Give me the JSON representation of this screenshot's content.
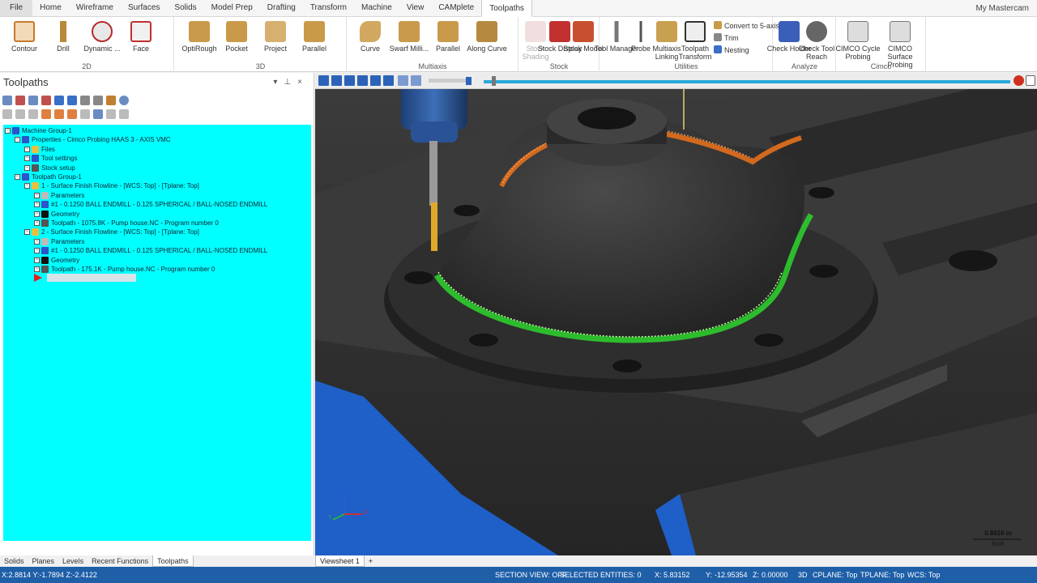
{
  "menu": {
    "tabs": [
      "File",
      "Home",
      "Wireframe",
      "Surfaces",
      "Solids",
      "Model Prep",
      "Drafting",
      "Transform",
      "Machine",
      "View",
      "CAMplete",
      "Toolpaths"
    ],
    "active": "Toolpaths",
    "account": "My Mastercam"
  },
  "ribbon": {
    "groups": {
      "g2d": "2D",
      "g3d": "3D",
      "multiaxis": "Multiaxis",
      "stock": "Stock",
      "utilities": "Utilities",
      "analyze": "Analyze",
      "cimco": "Cimco"
    },
    "buttons": {
      "contour": "Contour",
      "drill": "Drill",
      "dynamic": "Dynamic ...",
      "face": "Face",
      "optirough": "OptiRough",
      "pocket": "Pocket",
      "project": "Project",
      "parallel3d": "Parallel",
      "curve": "Curve",
      "swarf": "Swarf Milli...",
      "parallel_ma": "Parallel",
      "along_curve": "Along Curve",
      "stock_shading": "Stock Shading",
      "stock_display": "Stock Display",
      "stock_model": "Stock Model",
      "tool_manager": "Tool Manager",
      "probe": "Probe",
      "multiaxis_linking": "Multiaxis Linking",
      "toolpath_transform": "Toolpath Transform",
      "convert_5axis": "Convert to 5-axis",
      "trim": "Trim",
      "nesting": "Nesting",
      "check_holder": "Check Holder",
      "check_reach": "Check Tool Reach",
      "cimco_cycle": "CIMCO Cycle Probing",
      "cimco_surface": "CIMCO Surface Probing"
    }
  },
  "panel": {
    "title": "Toolpaths",
    "tree": [
      {
        "indent": 0,
        "text": "Machine Group-1",
        "icon": "#2b55c8"
      },
      {
        "indent": 1,
        "text": "Properties - Cimco Probing HAAS 3 - AXIS VMC",
        "icon": "#2b55c8"
      },
      {
        "indent": 2,
        "text": "Files",
        "icon": "#e8c040"
      },
      {
        "indent": 2,
        "text": "Tool settings",
        "icon": "#2b55c8"
      },
      {
        "indent": 2,
        "text": "Stock setup",
        "icon": "#555555"
      },
      {
        "indent": 1,
        "text": "Toolpath Group-1",
        "icon": "#2b55c8"
      },
      {
        "indent": 2,
        "text": "1 - Surface Finish Flowline - [WCS: Top] - [Tplane: Top]",
        "icon": "#e8c040"
      },
      {
        "indent": 3,
        "text": "Parameters",
        "icon": "#bbbbbb"
      },
      {
        "indent": 3,
        "text": "#1 - 0.1250 BALL ENDMILL - 0.125 SPHERICAL / BALL-NOSED ENDMILL",
        "icon": "#2b55c8"
      },
      {
        "indent": 3,
        "text": "Geometry",
        "icon": "#111111"
      },
      {
        "indent": 3,
        "text": "Toolpath - 1075.8K - Pump house.NC - Program number 0",
        "icon": "#555555"
      },
      {
        "indent": 2,
        "text": "2 - Surface Finish Flowline - [WCS: Top] - [Tplane: Top]",
        "icon": "#e8c040"
      },
      {
        "indent": 3,
        "text": "Parameters",
        "icon": "#bbbbbb"
      },
      {
        "indent": 3,
        "text": "#1 - 0.1250 BALL ENDMILL - 0.125 SPHERICAL / BALL-NOSED ENDMILL",
        "icon": "#2b55c8"
      },
      {
        "indent": 3,
        "text": "Geometry",
        "icon": "#111111"
      },
      {
        "indent": 3,
        "text": "Toolpath - 175.1K - Pump house.NC - Program number 0",
        "icon": "#555555"
      }
    ],
    "bottom_tabs": [
      "Solids",
      "Planes",
      "Levels",
      "Recent Functions",
      "Toolpaths"
    ],
    "bottom_active": "Toolpaths"
  },
  "viewport": {
    "view_tab": "Viewsheet 1",
    "add_tab": "+",
    "scale_value": "0.8616 in",
    "scale_unit": "Inch",
    "axis_z": "Z",
    "axis_y": "Y",
    "axis_x": "X"
  },
  "status": {
    "coords": "X:2.8814   Y:-1.7894   Z:-2.4122",
    "section_view": "SECTION VIEW: OFF",
    "selected": "SELECTED ENTITIES: 0",
    "x_label": "X:",
    "x_val": "5.83152",
    "y_label": "Y:",
    "y_val": "-12.95354",
    "z_label": "Z:",
    "z_val": "0.00000",
    "mode": "3D",
    "cplane": "CPLANE: Top",
    "tplane": "TPLANE: Top",
    "wcs": "WCS: Top"
  },
  "colors": {
    "tree_bg": "#00ffff",
    "status_bg": "#1e5fa8",
    "toolpath_green": "#2ecc2e",
    "toolpath_orange": "#d2691e"
  }
}
